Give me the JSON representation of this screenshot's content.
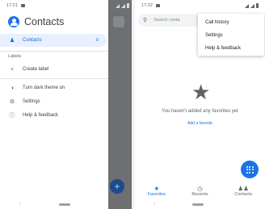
{
  "left_screen": {
    "status": {
      "time": "17:21"
    },
    "drawer": {
      "app_title": "Contacts",
      "contacts_item": {
        "label": "Contacts",
        "count": "0"
      },
      "labels_section": "Labels",
      "create_label": "Create label",
      "dark_theme": "Turn dark theme on",
      "settings": "Settings",
      "help": "Help & feedback"
    },
    "fab_icon": "+"
  },
  "right_screen": {
    "status": {
      "time": "17:22"
    },
    "search": {
      "placeholder": "Search conta"
    },
    "overflow_menu": [
      "Call history",
      "Settings",
      "Help & feedback"
    ],
    "empty_state": {
      "message": "You haven't added any favorites yet",
      "action": "Add a favorite"
    },
    "tabs": [
      {
        "label": "Favorites",
        "icon": "star-icon",
        "active": true
      },
      {
        "label": "Recents",
        "icon": "clock-icon",
        "active": false
      },
      {
        "label": "Contacts",
        "icon": "people-icon",
        "active": false
      }
    ]
  },
  "colors": {
    "accent": "#1a73e8",
    "active_item_bg": "#e8f0fe",
    "scrim": "#6d6f72"
  }
}
